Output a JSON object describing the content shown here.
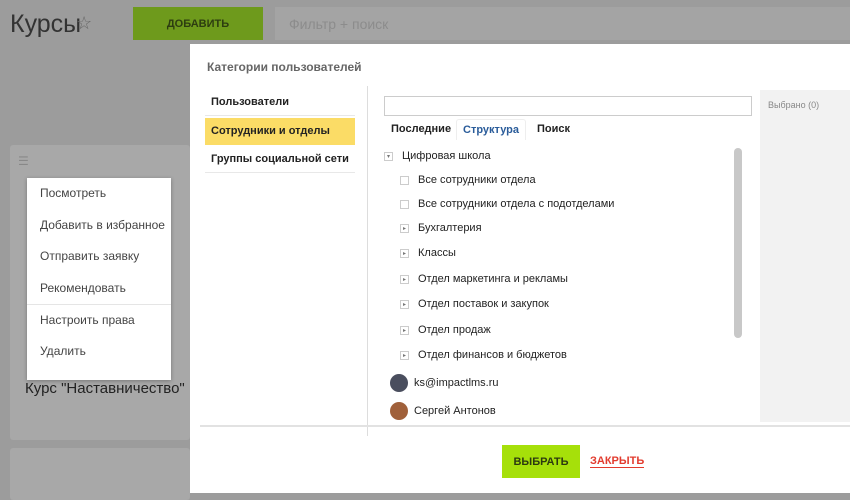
{
  "header": {
    "title": "Курсы",
    "add_label": "ДОБАВИТЬ",
    "filter_placeholder": "Фильтр + поиск"
  },
  "context_menu": [
    "Посмотреть",
    "Добавить в избранное",
    "Отправить заявку",
    "Рекомендовать",
    "Настроить права",
    "Удалить"
  ],
  "course_title": "Курс \"Наставничество\"",
  "modal": {
    "title": "Категории пользователей",
    "left_menu": [
      "Пользователи",
      "Сотрудники и отделы",
      "Группы социальной сети"
    ],
    "tabs": [
      "Последние",
      "Структура",
      "Поиск"
    ],
    "root": "Цифровая школа",
    "checks": [
      "Все сотрудники отдела",
      "Все сотрудники отдела с подотделами"
    ],
    "departments": [
      "Бухгалтерия",
      "Классы",
      "Отдел маркетинга и рекламы",
      "Отдел поставок и закупок",
      "Отдел продаж",
      "Отдел финансов и бюджетов"
    ],
    "users": [
      "ks@impactlms.ru",
      "Сергей Антонов"
    ],
    "selected": "Выбрано (0)",
    "ok": "ВЫБРАТЬ",
    "close": "ЗАКРЫТЬ"
  }
}
